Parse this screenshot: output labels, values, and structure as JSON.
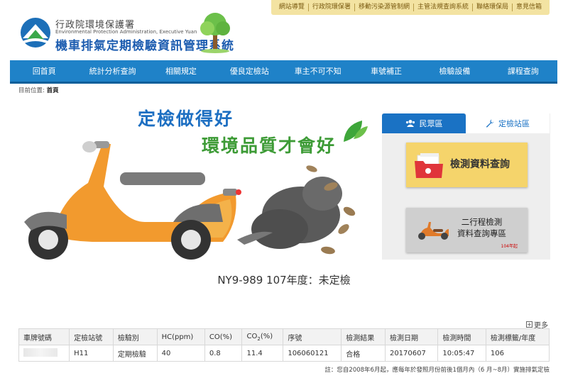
{
  "top_links": [
    "網站導覽",
    "行政院環保署",
    "移動污染源管制網",
    "主管法規查詢系統",
    "聯絡環保局",
    "意見信箱"
  ],
  "logo": {
    "org_zh": "行政院環境保護署",
    "org_en": "Environmental Protection Administration, Executive Yuan",
    "system_title": "機車排氣定期檢驗資訊管理系統"
  },
  "nav": [
    "回首頁",
    "統計分析查詢",
    "相關規定",
    "優良定檢站",
    "車主不可不知",
    "車號補正",
    "檢驗設備",
    "課程查詢"
  ],
  "breadcrumb": {
    "prefix": "目前位置:",
    "current": "首頁"
  },
  "banner": {
    "slogan1": "定檢做得好",
    "slogan2": "環境品質才會好"
  },
  "side_tabs": {
    "public": "民眾區",
    "station": "定檢站區"
  },
  "cards": {
    "inspection_query": "檢測資料查詢",
    "two_stroke_line1": "二行程檢測",
    "two_stroke_line2": "資料查詢專區",
    "two_stroke_tag": "104年起"
  },
  "result_title": "NY9-989 107年度：未定檢",
  "more_label": "更多",
  "table": {
    "headers": [
      "車牌號碼",
      "定檢站號",
      "檢驗別",
      "HC(ppm)",
      "CO(%)",
      "CO2(%)",
      "序號",
      "檢測結果",
      "檢測日期",
      "檢測時間",
      "檢測標籤/年度"
    ],
    "row": [
      "",
      "H11",
      "定期檢驗",
      "40",
      "0.8",
      "11.4",
      "106060121",
      "合格",
      "20170607",
      "10:05:47",
      "106"
    ]
  },
  "note": "註：您自2008年6月起，應每年於發照月份前後1個月內（6 月~8月）實施排氣定檢",
  "colors": {
    "nav": "#1f82c8",
    "title_blue": "#1d5db0",
    "slogan_green": "#3d9b36",
    "card_yellow": "#f5d46b"
  }
}
